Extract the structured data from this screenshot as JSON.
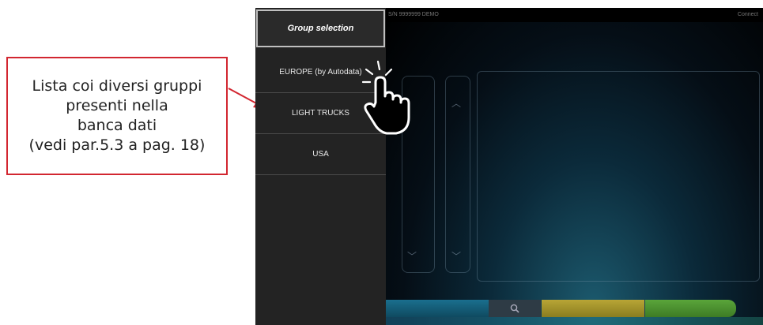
{
  "callout": {
    "lines": [
      "Lista coi diversi gruppi",
      "presenti nella",
      "banca dati",
      "(vedi par.5.3 a pag. 18)"
    ],
    "border_color": "#d22630"
  },
  "topbar": {
    "serial": "S/N 9999999 DEMO",
    "status": "Connect"
  },
  "sidebar": {
    "header": "Group selection",
    "items": [
      {
        "label": "EUROPE (by Autodata)"
      },
      {
        "label": "LIGHT TRUCKS"
      },
      {
        "label": "USA"
      }
    ]
  },
  "bottom_bar": {
    "search_icon": "search-icon",
    "colors": {
      "blue": "#1a6f8e",
      "yellow": "#b8a536",
      "green": "#5aa53a"
    }
  },
  "hand_icon": "pointing-hand-icon"
}
